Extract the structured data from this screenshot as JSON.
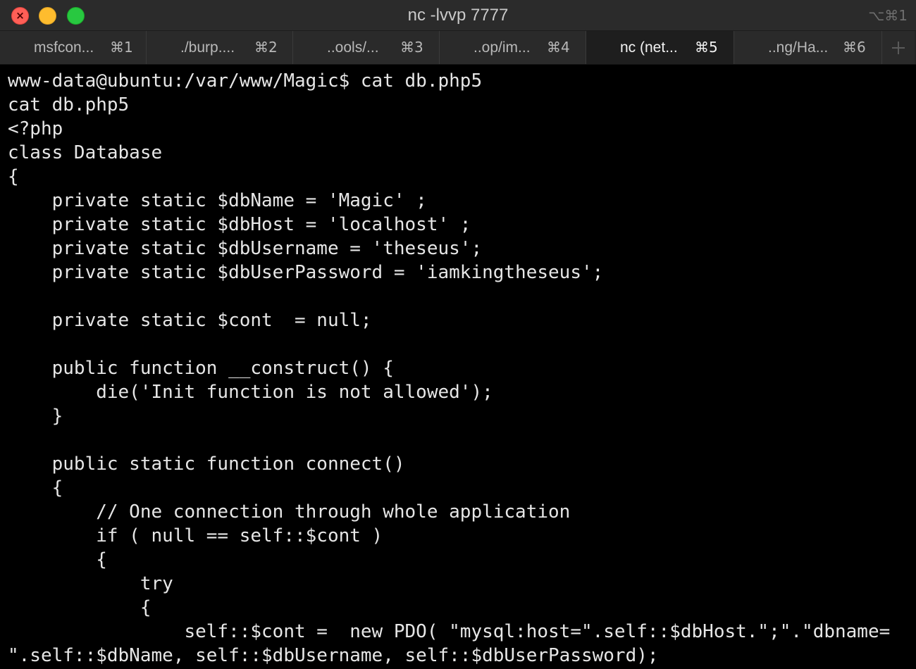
{
  "window": {
    "title": "nc -lvvp 7777",
    "shortcut": "⌥⌘1",
    "close_glyph": "×",
    "colors": {
      "close": "#ff5f57",
      "minimize": "#febc2e",
      "zoom": "#28c840"
    }
  },
  "tabs": [
    {
      "label": "msfcon...",
      "shortcut": "⌘1",
      "active": false
    },
    {
      "label": "./burp....",
      "shortcut": "⌘2",
      "active": false
    },
    {
      "label": "..ools/...",
      "shortcut": "⌘3",
      "active": false
    },
    {
      "label": "..op/im...",
      "shortcut": "⌘4",
      "active": false
    },
    {
      "label": "nc (net...",
      "shortcut": "⌘5",
      "active": true
    },
    {
      "label": "..ng/Ha...",
      "shortcut": "⌘6",
      "active": false
    }
  ],
  "new_tab_icon": "plus-icon",
  "terminal": {
    "background": "#000000",
    "foreground": "#e6e6e6",
    "lines": [
      "www-data@ubuntu:/var/www/Magic$ cat db.php5",
      "cat db.php5",
      "<?php",
      "class Database",
      "{",
      "    private static $dbName = 'Magic' ;",
      "    private static $dbHost = 'localhost' ;",
      "    private static $dbUsername = 'theseus';",
      "    private static $dbUserPassword = 'iamkingtheseus';",
      "",
      "    private static $cont  = null;",
      "",
      "    public function __construct() {",
      "        die('Init function is not allowed');",
      "    }",
      "",
      "    public static function connect()",
      "    {",
      "        // One connection through whole application",
      "        if ( null == self::$cont )",
      "        {",
      "            try",
      "            {",
      "                self::$cont =  new PDO( \"mysql:host=\".self::$dbHost.\";\".\"dbname=",
      "\".self::$dbName, self::$dbUsername, self::$dbUserPassword);"
    ]
  }
}
